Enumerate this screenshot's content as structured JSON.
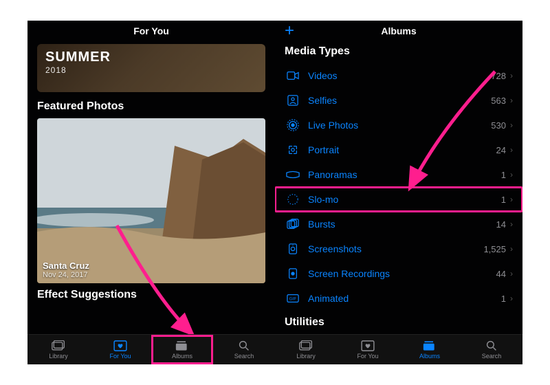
{
  "left": {
    "nav_title": "For You",
    "memory": {
      "title": "SUMMER",
      "year": "2018"
    },
    "featured_heading": "Featured Photos",
    "featured_caption": {
      "place": "Santa Cruz",
      "date": "Nov 24, 2017"
    },
    "effect_heading": "Effect Suggestions",
    "tabs": {
      "library": "Library",
      "foryou": "For You",
      "albums": "Albums",
      "search": "Search"
    }
  },
  "right": {
    "nav_title": "Albums",
    "section_media": "Media Types",
    "section_util": "Utilities",
    "rows": [
      {
        "icon": "videos",
        "label": "Videos",
        "count": "728"
      },
      {
        "icon": "selfies",
        "label": "Selfies",
        "count": "563"
      },
      {
        "icon": "live",
        "label": "Live Photos",
        "count": "530"
      },
      {
        "icon": "portrait",
        "label": "Portrait",
        "count": "24"
      },
      {
        "icon": "panoramas",
        "label": "Panoramas",
        "count": "1"
      },
      {
        "icon": "slomo",
        "label": "Slo-mo",
        "count": "1",
        "highlight": true
      },
      {
        "icon": "bursts",
        "label": "Bursts",
        "count": "14"
      },
      {
        "icon": "screenshots",
        "label": "Screenshots",
        "count": "1,525"
      },
      {
        "icon": "recordings",
        "label": "Screen Recordings",
        "count": "44"
      },
      {
        "icon": "animated",
        "label": "Animated",
        "count": "1"
      }
    ],
    "tabs": {
      "library": "Library",
      "foryou": "For You",
      "albums": "Albums",
      "search": "Search"
    }
  }
}
